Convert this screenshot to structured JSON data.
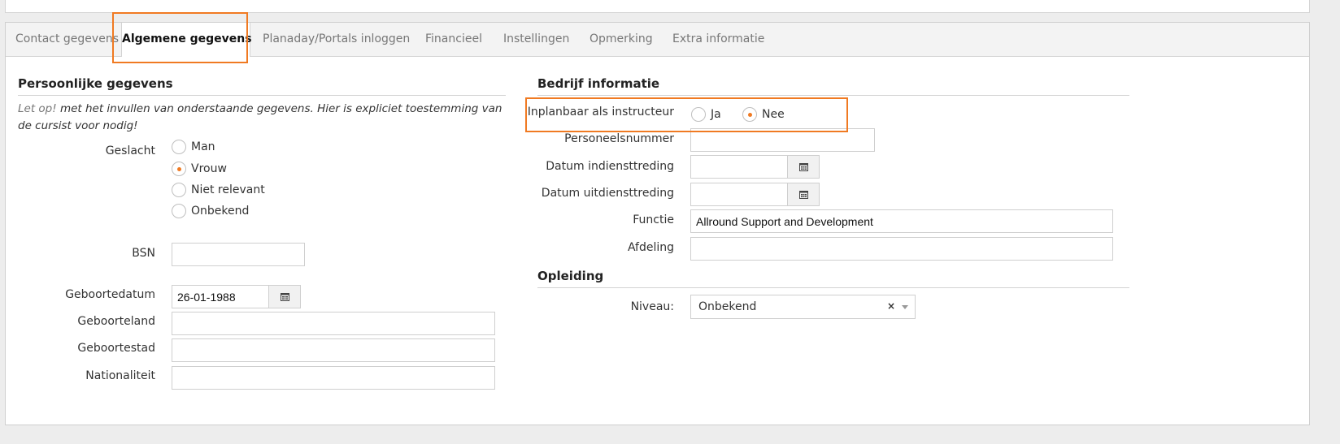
{
  "tabs": [
    {
      "label": "Contact gegevens",
      "active": false
    },
    {
      "label": "Algemene gegevens",
      "active": true
    },
    {
      "label": "Planaday/Portals inloggen",
      "active": false
    },
    {
      "label": "Financieel",
      "active": false
    },
    {
      "label": "Instellingen",
      "active": false
    },
    {
      "label": "Opmerking",
      "active": false
    },
    {
      "label": "Extra informatie",
      "active": false
    }
  ],
  "personal": {
    "title": "Persoonlijke gegevens",
    "note_prefix": "Let op!",
    "note_rest": " met het invullen van onderstaande gegevens. Hier is expliciet toestemming van de cursist voor nodig!",
    "gender_label": "Geslacht",
    "gender_options": [
      "Man",
      "Vrouw",
      "Niet relevant",
      "Onbekend"
    ],
    "gender_selected": "Vrouw",
    "bsn_label": "BSN",
    "bsn_value": "",
    "birthdate_label": "Geboortedatum",
    "birthdate_value": "26-01-1988",
    "birthcountry_label": "Geboorteland",
    "birthcountry_value": "",
    "birthcity_label": "Geboortestad",
    "birthcity_value": "",
    "nationality_label": "Nationaliteit",
    "nationality_value": ""
  },
  "company": {
    "title": "Bedrijf informatie",
    "instructor_label": "Inplanbaar als instructeur",
    "instructor_options": [
      "Ja",
      "Nee"
    ],
    "instructor_selected": "Nee",
    "staffno_label": "Personeelsnummer",
    "staffno_value": "",
    "startdate_label": "Datum indiensttreding",
    "startdate_value": "",
    "enddate_label": "Datum uitdiensttreding",
    "enddate_value": "",
    "function_label": "Functie",
    "function_value": "Allround Support and Development",
    "department_label": "Afdeling",
    "department_value": ""
  },
  "education": {
    "title": "Opleiding",
    "level_label": "Niveau:",
    "level_value": "Onbekend",
    "clear_glyph": "×"
  },
  "icons": {
    "calendar": "calendar-icon",
    "dropdown": "chevron-down-icon"
  },
  "colors": {
    "accent": "#f07a22",
    "highlight": "#f07a22"
  }
}
